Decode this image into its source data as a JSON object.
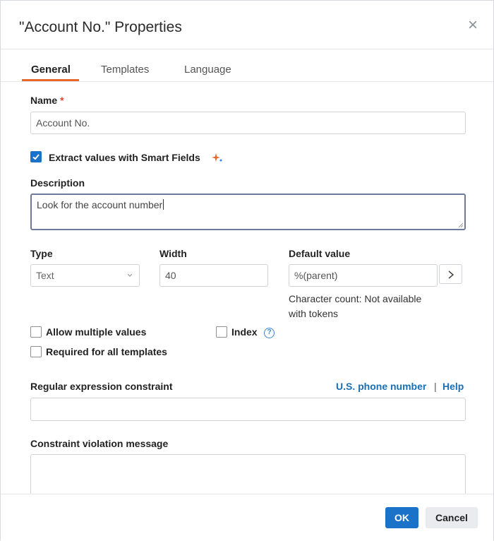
{
  "dialog": {
    "title": "\"Account No.\" Properties",
    "close_symbol": "×"
  },
  "tabs": [
    {
      "label": "General",
      "active": true
    },
    {
      "label": "Templates",
      "active": false
    },
    {
      "label": "Language",
      "active": false
    }
  ],
  "name": {
    "label": "Name",
    "required_marker": "*",
    "value": "Account No."
  },
  "smart_fields": {
    "label": "Extract values with Smart Fields",
    "checked": true,
    "icon": "sparkle-icon"
  },
  "description": {
    "label": "Description",
    "value": "Look for the account number"
  },
  "type": {
    "label": "Type",
    "selected": "Text"
  },
  "width": {
    "label": "Width",
    "value": "40"
  },
  "default_value": {
    "label": "Default value",
    "value": "%(parent)",
    "char_count_line1": "Character count: Not available",
    "char_count_line2": "with tokens"
  },
  "options": {
    "allow_multiple": {
      "label": "Allow multiple values",
      "checked": false
    },
    "index": {
      "label": "Index",
      "checked": false,
      "help_glyph": "?"
    },
    "required_all": {
      "label": "Required for all templates",
      "checked": false
    }
  },
  "regex": {
    "label": "Regular expression constraint",
    "link_phone": "U.S. phone number",
    "separator": "|",
    "link_help": "Help",
    "value": ""
  },
  "violation": {
    "label": "Constraint violation message",
    "value": ""
  },
  "footer": {
    "ok_label": "OK",
    "cancel_label": "Cancel"
  },
  "colors": {
    "accent": "#1a73c8",
    "tab_underline": "#e8672a",
    "required": "#d9452b"
  }
}
